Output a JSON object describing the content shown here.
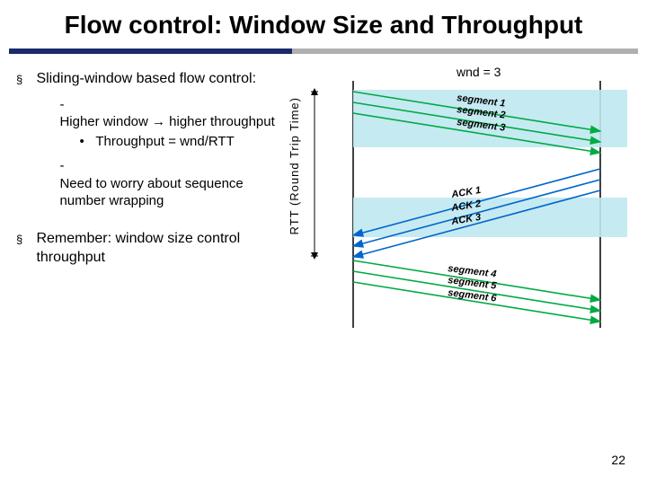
{
  "title": "Flow control: Window Size and Throughput",
  "bullets": {
    "b1": {
      "text": "Sliding-window based flow control:",
      "sub": {
        "s1": {
          "text": "Higher window → higher throughput",
          "sub": {
            "t1": "Throughput = wnd/RTT"
          }
        },
        "s2": {
          "text": "Need to worry about sequence number wrapping"
        }
      }
    },
    "b2": {
      "text": "Remember: window size control throughput"
    }
  },
  "diagram": {
    "rtt_label": "RTT (Round Trip Time)",
    "wnd_label": "wnd = 3",
    "seg1": "segment 1",
    "seg2": "segment 2",
    "seg3": "segment 3",
    "ack1": "ACK 1",
    "ack2": "ACK 2",
    "ack3": "ACK 3",
    "seg4": "segment 4",
    "seg5": "segment 5",
    "seg6": "segment 6"
  },
  "page_number": "22"
}
